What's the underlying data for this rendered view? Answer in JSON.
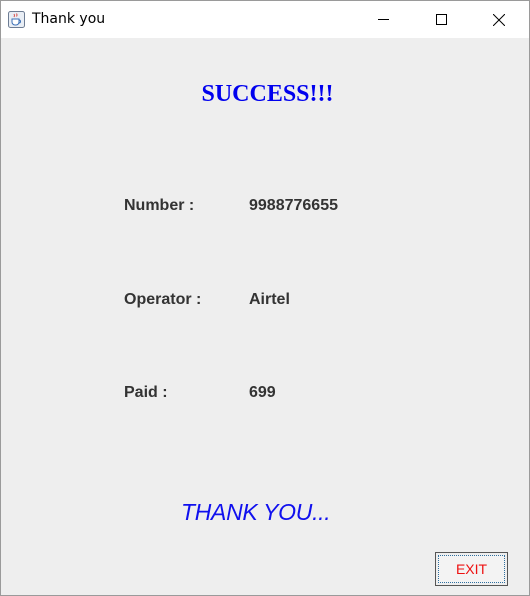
{
  "window": {
    "title": "Thank you",
    "icon": "java-cup-icon",
    "controls": [
      "minimize-icon",
      "maximize-icon",
      "close-icon"
    ]
  },
  "content": {
    "heading": "SUCCESS!!!",
    "rows": [
      {
        "label": "Number :",
        "value": "9988776655"
      },
      {
        "label": "Operator :",
        "value": "Airtel"
      },
      {
        "label": "Paid :",
        "value": "699"
      }
    ],
    "thank_you": "THANK YOU...",
    "exit_label": "EXIT"
  },
  "colors": {
    "heading": "#0000ee",
    "thank_you": "#1010ee",
    "exit_text": "#ee1111",
    "background": "#eeeeee"
  }
}
